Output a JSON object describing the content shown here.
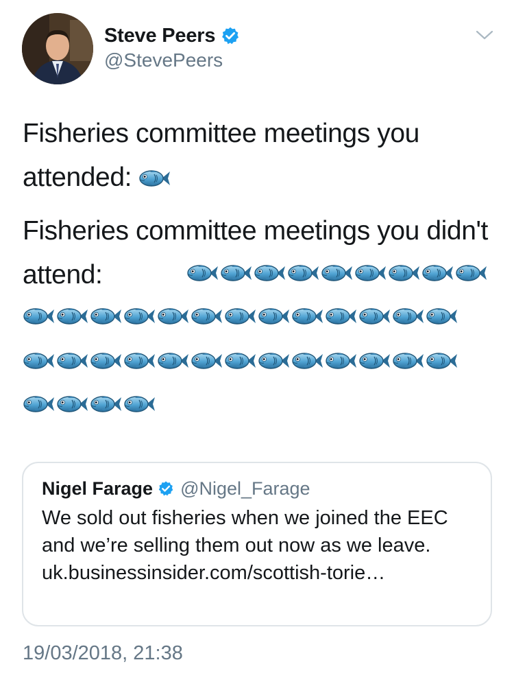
{
  "author": {
    "display_name": "Steve Peers",
    "handle": "@StevePeers",
    "verified": true
  },
  "tweet": {
    "line1": "Fisheries committee meetings you attended:",
    "attended_fish_count": 1,
    "line2": "Fisheries committee meetings you didn't attend:",
    "not_attended_fish_count": 39
  },
  "quoted_tweet": {
    "display_name": "Nigel Farage",
    "handle": "@Nigel_Farage",
    "verified": true,
    "text": "We sold out fisheries when we joined the EEC and we’re selling them out now as we leave. uk.businessinsider.com/scottish-torie…"
  },
  "timestamp": "19/03/2018, 21:38",
  "icons": {
    "fish": "fish-emoji",
    "verified": "verified-badge-icon",
    "caret": "chevron-down-icon"
  },
  "colors": {
    "verified_blue": "#1da1f2",
    "secondary_text": "#657786",
    "border": "#dfe4e8"
  }
}
